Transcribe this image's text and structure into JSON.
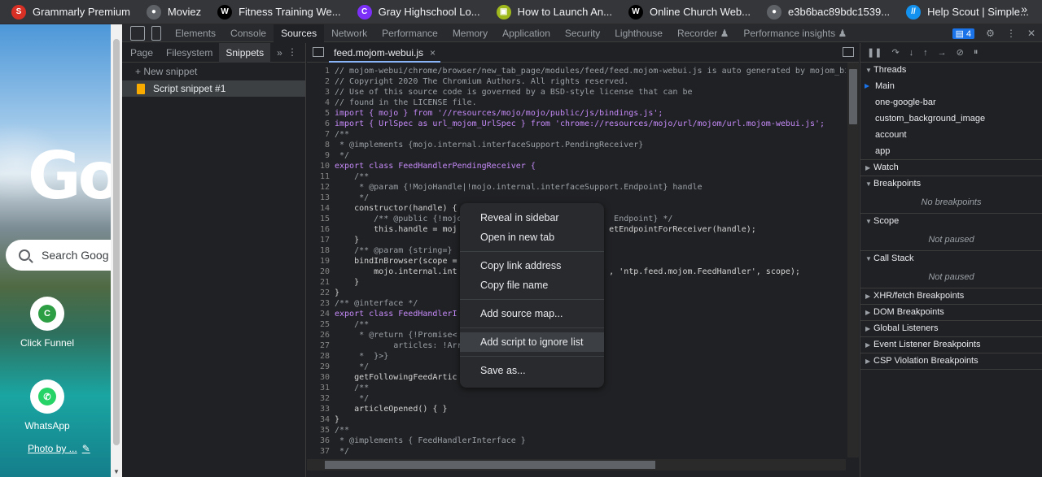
{
  "bookmarks": {
    "items": [
      {
        "label": "Grammarly Premium",
        "icon": "grammarly-icon",
        "color": "#d93025",
        "glyph": "S"
      },
      {
        "label": "Moviez",
        "icon": "globe-icon",
        "color": "#5f6368",
        "glyph": "●"
      },
      {
        "label": "Fitness Training We...",
        "icon": "wix-icon",
        "color": "#000000",
        "glyph": "W"
      },
      {
        "label": "Gray Highschool Lo...",
        "icon": "canva-icon",
        "color": "#7b2ff7",
        "glyph": "C"
      },
      {
        "label": "How to Launch An...",
        "icon": "square-logo-icon",
        "color": "#9fb81c",
        "glyph": "▣"
      },
      {
        "label": "Online Church Web...",
        "icon": "wix-icon",
        "color": "#000000",
        "glyph": "W"
      },
      {
        "label": "e3b6bac89bdc1539...",
        "icon": "globe-icon",
        "color": "#5f6368",
        "glyph": "●"
      },
      {
        "label": "Help Scout | Simple...",
        "icon": "helpscout-icon",
        "color": "#1292ee",
        "glyph": "//"
      }
    ],
    "more": "»"
  },
  "new_tab": {
    "logo": "Go",
    "search_placeholder": "Search Goog",
    "shortcuts": [
      {
        "label": "Click Funnel",
        "icon": "clickfunnel-icon",
        "color": "#2e9e44",
        "glyph": "C"
      },
      {
        "label": "WhatsApp",
        "icon": "whatsapp-icon",
        "color": "#25d366",
        "glyph": "✆"
      }
    ],
    "photo_by": "Photo by ..."
  },
  "devtools": {
    "tabs": [
      "Elements",
      "Console",
      "Sources",
      "Network",
      "Performance",
      "Memory",
      "Application",
      "Security",
      "Lighthouse",
      "Recorder ♟",
      "Performance insights ♟"
    ],
    "active_tab": "Sources",
    "issues_count": "▤ 4",
    "navigator_tabs": [
      "Page",
      "Filesystem",
      "Snippets"
    ],
    "navigator_active": "Snippets",
    "new_snippet": "+ New snippet",
    "snippets": [
      "Script snippet #1"
    ],
    "editor_tab": "feed.mojom-webui.js",
    "code": [
      {
        "n": "1",
        "t": "// mojom-webui/chrome/browser/new_tab_page/modules/feed/feed.mojom-webui.js is auto generated by mojom_bi",
        "c": "cm"
      },
      {
        "n": "2",
        "t": "// Copyright 2020 The Chromium Authors. All rights reserved.",
        "c": "cm"
      },
      {
        "n": "3",
        "t": "// Use of this source code is governed by a BSD-style license that can be",
        "c": "cm"
      },
      {
        "n": "4",
        "t": "// found in the LICENSE file.",
        "c": "cm"
      },
      {
        "n": "5",
        "t": "import { mojo } from '//resources/mojo/mojo/public/js/bindings.js';",
        "c": "kw"
      },
      {
        "n": "6",
        "t": "import { UrlSpec as url_mojom_UrlSpec } from 'chrome://resources/mojo/url/mojom/url.mojom-webui.js';",
        "c": "kw"
      },
      {
        "n": "7",
        "t": "/**",
        "c": "cm"
      },
      {
        "n": "8",
        "t": " * @implements {mojo.internal.interfaceSupport.PendingReceiver}",
        "c": "cm"
      },
      {
        "n": "9",
        "t": " */",
        "c": "cm"
      },
      {
        "n": "10",
        "t": "export class FeedHandlerPendingReceiver {",
        "c": "kw"
      },
      {
        "n": "11",
        "t": "    /**",
        "c": "cm"
      },
      {
        "n": "12",
        "t": "     * @param {!MojoHandle|!mojo.internal.interfaceSupport.Endpoint} handle",
        "c": "cm"
      },
      {
        "n": "13",
        "t": "     */",
        "c": "cm"
      },
      {
        "n": "14",
        "t": "    constructor(handle) {",
        "c": ""
      },
      {
        "n": "15",
        "t": "        /** @public {!mojo.                              Endpoint} */",
        "c": "cm"
      },
      {
        "n": "16",
        "t": "        this.handle = moj                               etEndpointForReceiver(handle);",
        "c": ""
      },
      {
        "n": "17",
        "t": "    }",
        "c": ""
      },
      {
        "n": "18",
        "t": "    /** @param {string=}",
        "c": "cm"
      },
      {
        "n": "19",
        "t": "    bindInBrowser(scope =",
        "c": ""
      },
      {
        "n": "20",
        "t": "        mojo.internal.int                               , 'ntp.feed.mojom.FeedHandler', scope);",
        "c": ""
      },
      {
        "n": "21",
        "t": "    }",
        "c": ""
      },
      {
        "n": "22",
        "t": "}",
        "c": ""
      },
      {
        "n": "23",
        "t": "/** @interface */",
        "c": "cm"
      },
      {
        "n": "24",
        "t": "export class FeedHandlerI",
        "c": "kw"
      },
      {
        "n": "25",
        "t": "    /**",
        "c": "cm"
      },
      {
        "n": "26",
        "t": "     * @return {!Promise<",
        "c": "cm"
      },
      {
        "n": "27",
        "t": "            articles: !Arra",
        "c": "cm"
      },
      {
        "n": "28",
        "t": "     *  }>}",
        "c": "cm"
      },
      {
        "n": "29",
        "t": "     */",
        "c": "cm"
      },
      {
        "n": "30",
        "t": "    getFollowingFeedArtic",
        "c": ""
      },
      {
        "n": "31",
        "t": "    /**",
        "c": "cm"
      },
      {
        "n": "32",
        "t": "     */",
        "c": "cm"
      },
      {
        "n": "33",
        "t": "    articleOpened() { }",
        "c": ""
      },
      {
        "n": "34",
        "t": "}",
        "c": ""
      },
      {
        "n": "35",
        "t": "/**",
        "c": "cm"
      },
      {
        "n": "36",
        "t": " * @implements { FeedHandlerInterface }",
        "c": "cm"
      },
      {
        "n": "37",
        "t": " */",
        "c": "cm"
      }
    ],
    "context_menu": {
      "groups": [
        [
          "Reveal in sidebar",
          "Open in new tab"
        ],
        [
          "Copy link address",
          "Copy file name"
        ],
        [
          "Add source map..."
        ],
        [
          "Add script to ignore list"
        ],
        [
          "Save as..."
        ]
      ],
      "highlighted": "Add script to ignore list"
    },
    "debugger": {
      "threads_label": "Threads",
      "threads": [
        "Main",
        "one-google-bar",
        "custom_background_image",
        "account",
        "app"
      ],
      "watch_label": "Watch",
      "breakpoints_label": "Breakpoints",
      "no_breakpoints": "No breakpoints",
      "scope_label": "Scope",
      "scope_empty": "Not paused",
      "callstack_label": "Call Stack",
      "callstack_empty": "Not paused",
      "collapsed_sections": [
        "XHR/fetch Breakpoints",
        "DOM Breakpoints",
        "Global Listeners",
        "Event Listener Breakpoints",
        "CSP Violation Breakpoints"
      ]
    }
  }
}
